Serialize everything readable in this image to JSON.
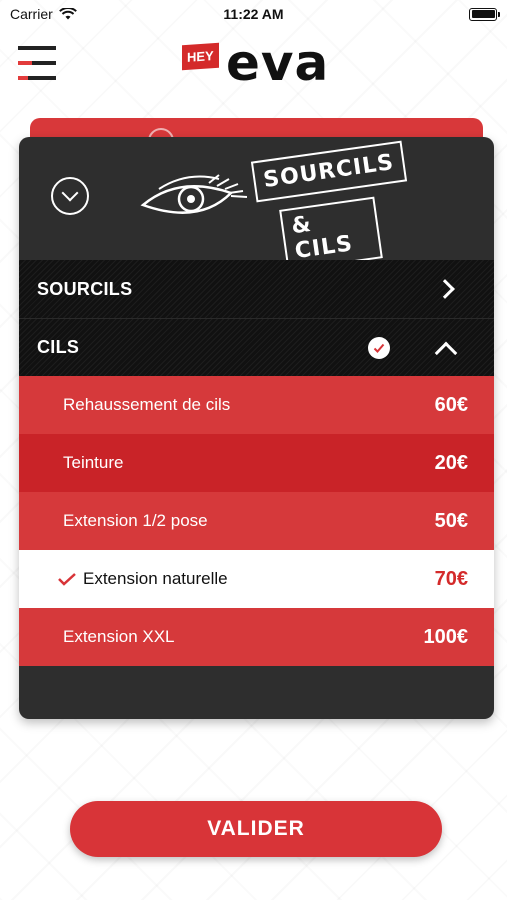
{
  "status_bar": {
    "carrier": "Carrier",
    "time": "11:22 AM"
  },
  "header": {
    "logo_hey": "HEY",
    "logo_eva": "eva"
  },
  "card": {
    "badge_line_1": "SOURCILS",
    "badge_line_2": "& CILS",
    "sections": [
      {
        "label": "SOURCILS",
        "expanded": false
      },
      {
        "label": "CILS",
        "expanded": true,
        "has_selection": true
      }
    ],
    "options": [
      {
        "label": "Rehaussement de cils",
        "price": "60€",
        "selected": false
      },
      {
        "label": "Teinture",
        "price": "20€",
        "selected": false
      },
      {
        "label": "Extension 1/2 pose",
        "price": "50€",
        "selected": false
      },
      {
        "label": "Extension naturelle",
        "price": "70€",
        "selected": true
      },
      {
        "label": "Extension XXL",
        "price": "100€",
        "selected": false
      }
    ]
  },
  "validate_label": "VALIDER",
  "colors": {
    "accent_red": "#d83438",
    "dark_card": "#2e2e2e",
    "black_row": "#111111"
  }
}
